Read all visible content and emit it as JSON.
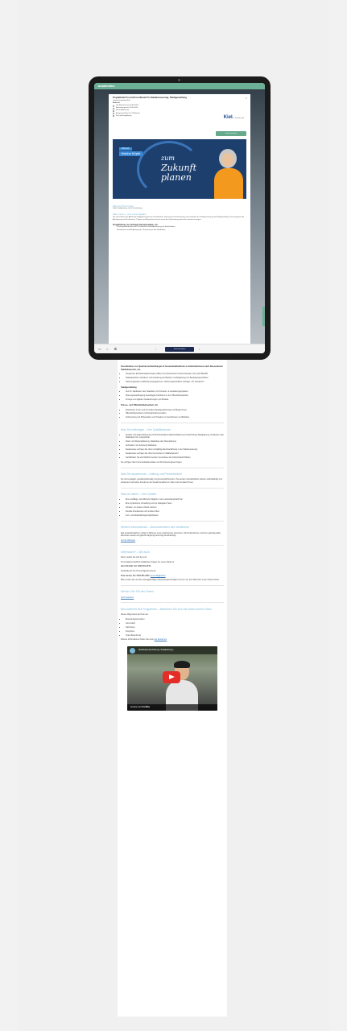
{
  "app": {
    "brand": "academics"
  },
  "job": {
    "title": "Projektleiter*in und Koordinator*in Stadterneuerung, Stadtgestaltung",
    "employer_line": "Landeshauptstadt Kiel",
    "type": "Befristet",
    "meta": [
      "Veröffentlicht am 03.06.2024",
      "Bewerbungsfrist 19.06.2024",
      "Keine Arbeitszeit",
      "Ausgeschrieben für 24 Monate",
      "Kiel und Umgebung"
    ],
    "logo_text": "Kiel.",
    "logo_sub": "Sailing City",
    "apply_label": "Jetzt bewerben",
    "close_label": "×"
  },
  "banner": {
    "tag1": "Sind wir:",
    "tag2": "frische Köpfe",
    "line1": "zum",
    "line2": "Zukunft",
    "line3": "planen"
  },
  "tablet_sections": {
    "wir_h": "Was wir Ihnen bieten",
    "wir_text": "Kiels Stadtplanung sucht Verstärkung",
    "aufgabe_h": "Was uns tun – Ihre neue Aufgabe",
    "aufgabe_text": "Sie unterstützen die Abteilung Stadtplanung bei der Koordination, Steuerung und Umsetzung von Projekten der Stadterneuerung und Stadtgestaltung. Dazu gehören die Abstimmung mit Fachämtern, Trägern und Eigentümer*innen sowie die Vorbereitung politischer Gremienvorlagen.",
    "proj_h": "Projektleitung von wichtigen Einzelprojekten, d.h.",
    "proj_items": [
      "Planungskoordination der Fachbereiche und Abstimmung mit Stakeholdern",
      "Koordination und Begleitung der Umsetzung in den Stadtteilen"
    ]
  },
  "bottombar": {
    "apply_label": "Jetzt bewerben"
  },
  "content": {
    "top_h": "Koordination von Quartiersentwicklungen & Gesamtmaßnahmen in Gebietskulissen nach Besonderem Städtebaurecht, d.h.",
    "top_items": [
      "Integrierten Entwicklungskonzepten (IEK) und vorbereitende Untersuchungen (VU) nach BauGB",
      "Städtebaulichen Verfahren und Auslobung der Bauherr und Begleitung von Beteiligungsverfahren",
      "Sanierungszielen, Maßnahmenprogrammen, Sanierungsrechtliche Vorträge, z.B. Sozialer*in"
    ],
    "stadt_h": "Stadtgestaltung",
    "stadt_items": [
      "Auch in Stadtteilen oder Stadtteilen mit Freiraum- & Gestaltungsprojekten",
      "Planungsbeauftragung beauftragter Fachbüros in der Öffentlichkeitsarbeit",
      "Anzeige und digitale Visualisierungen und Modelle"
    ],
    "presse_h": "Presse- und Öffentlichkeitsarbeit, d.h.",
    "presse_items": [
      "Workshops, Foren und innovative Beteiligungsformate mit Bürger*innen",
      "Öffentlichkeitsarbeit und Projekt-Dokumentation",
      "Vorbereitung und Präsentation von Projekten in Ausschüssen und Beiräten"
    ],
    "mit_h": "Was Sie mitbringen – Ihre Qualifikationen",
    "mit_items": [
      "Studium: Ein abgeschlossenes Hochschulstudium (Diplom/Master) der Fachrichtung Stadtplanung, Architektur oder Städtebau bzw. vergleichbar",
      "Stadt- und Regionalplanung, Städtebau oder Raumplanung",
      "Architektur mit Vertiefung Städtebau",
      "Idealerweise verfügen Sie über mehrjährige Berufserfahrung in der Stadterneuerung",
      "Idealerweise verfügen Sie über Kenntnisse im Städtebaurecht",
      "Fachlichkeit: Sie sind fachlich versiert, Kenntnisse der Fördermittelrichtlinien"
    ],
    "mit_text": "Sie verfügen über Kommunikationsstärke und Durchsetzungsvermögen.",
    "aus_h": "Was Sie auszeichnet – Haltung und Persönlichkeit",
    "aus_text": "Sie sind engagiert, gestaltungsfreudig und gemeinwohlorientiert. Sie denken interdisziplinär, arbeiten selbstständig und strukturiert und haben Freude an der Zusammenarbeit im Team und mit Akteur*innen.",
    "bieten_h": "Was wir bieten – Ihre Vorteile",
    "bieten_items": [
      "Eine vielfältige, sinnstiftende Tätigkeit in der Landeshauptstadt Kiel",
      "Eine dynamische Verwaltung und ein kollegiales Team",
      "Arbeiten, wo andere Urlaub machen",
      "Flexible Arbeitszeiten und mobile Arbeit",
      "Fort- und Weiterbildungsmöglichkeiten"
    ],
    "info_h": "Weitere Informationen – Besonderheiten des Verfahrens",
    "info_text": "Das Auswahlverfahren erfolgt im Rahmen eines strukturierten Interviews. Schwerbehinderte und ihnen gleichgestellte Menschen werden bei gleicher Eignung bevorzugt berücksichtigt.",
    "info_link": "Auf die Webseite",
    "fragen_h": "Interessiert? – Wir auch.",
    "fragen_text": "Dann melden Sie sich bei uns!",
    "contact1": "Ihr Kontakt bei fachlich-inhaltlichen Fragen zur neuen Stelle ist",
    "contact1_name": "Herr Schmidt, Tel. 0431 901-2744.",
    "contact2": "Zuständig für Ihre Personalgewinnung ist",
    "contact2_name": "Frau Larsen, Tel. 0431 901-2237,",
    "contact2_link": "personal@kiel.de",
    "deadline_text": "Bitte senden Sie uns Ihre aussagekräftigen Bewerbungsunterlagen bis zum 19. Juni 2024 über unser Online-Portal.",
    "werden_h": "Werden Sie Teil des Teams.",
    "werden_link": "Jetzt bewerben",
    "beson_h": "Besonderheit des Programms – Bewerben Sie sich mit einem kurzen Video",
    "beson_text": "Diesen Weg bieten wir Ihnen an:",
    "beson_items": [
      "Bewerbungsschreiben",
      "Lebenslauf",
      "Nachweise",
      "Zeugnisse",
      "Video-Bewerbung"
    ],
    "beson_text2": "Weitere Informationen finden Sie unter",
    "beson_link": "kiel.de/karriere",
    "video_title": "Mitarbeitende Planung: Stadtplanung...",
    "video_watch": "Ansehen auf",
    "video_youtube": "YouTube"
  }
}
